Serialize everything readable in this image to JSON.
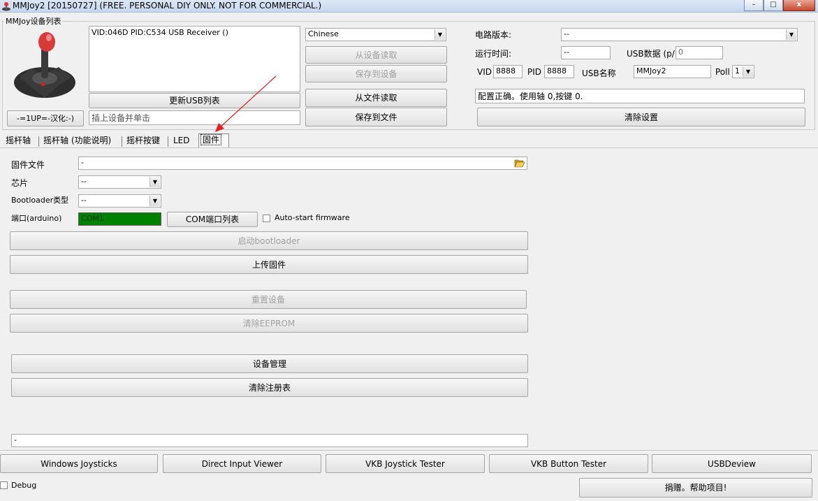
{
  "window": {
    "title": "MMJoy2 [20150727] (FREE. PERSONAL DIY ONLY. NOT FOR COMMERCIAL.)",
    "controls": {
      "minimize": "–",
      "maximize": "□",
      "close": "x"
    }
  },
  "device_list": {
    "group_label": "MMJoy设备列表",
    "devices": [
      "VID:046D PID:C534 USB Receiver ()"
    ],
    "refresh_label": "更新USB列表",
    "hint": "插上设备并单击",
    "credit_button": "-=1UP=-汉化:-)"
  },
  "language": {
    "selected": "Chinese"
  },
  "device_actions": {
    "read_device": "从设备读取",
    "save_device": "保存到设备",
    "read_file": "从文件读取",
    "save_file": "保存到文件"
  },
  "info": {
    "board_version_label": "电路版本:",
    "board_version_value": "--",
    "runtime_label": "运行时间:",
    "runtime_value": "--",
    "usb_data_label": "USB数据 (p/",
    "usb_data_value": "0",
    "vid_label": "VID",
    "vid_value": "8888",
    "pid_label": "PID",
    "pid_value": "8888",
    "usb_name_label": "USB名称",
    "usb_name_value": "MMJoy2",
    "poll_label": "Poll",
    "poll_value": "1",
    "status_message": "配置正确。使用轴 0,按键 0.",
    "clear_settings": "清除设置"
  },
  "tabs": [
    {
      "label": "摇杆轴"
    },
    {
      "label": "摇杆轴 (功能说明)"
    },
    {
      "label": "摇杆按键"
    },
    {
      "label": "LED"
    },
    {
      "label": "固件",
      "active": true
    }
  ],
  "firmware": {
    "file_label": "固件文件",
    "file_value": "-",
    "chip_label": "芯片",
    "chip_value": "--",
    "bootloader_label": "Bootloader类型",
    "bootloader_value": "--",
    "port_label": "端口(arduino)",
    "port_value": "COM1",
    "com_list_button": "COM端口列表",
    "autostart_label": "Auto-start firmware",
    "start_bootloader": "启动bootloader",
    "upload_firmware": "上传固件",
    "reset_device": "重置设备",
    "clear_eeprom": "清除EEPROM",
    "device_manager": "设备管理",
    "clear_registry": "清除注册表",
    "log_value": "-"
  },
  "bottom_buttons": {
    "windows_joysticks": "Windows Joysticks",
    "direct_input_viewer": "Direct Input Viewer",
    "vkb_joystick_tester": "VKB Joystick Tester",
    "vkb_button_tester": "VKB Button Tester",
    "usbdeview": "USBDeview",
    "debug_label": "Debug",
    "donate": "捐赠。帮助项目!"
  },
  "colors": {
    "port_status": "#008000",
    "annotation_arrow": "#e02020"
  }
}
